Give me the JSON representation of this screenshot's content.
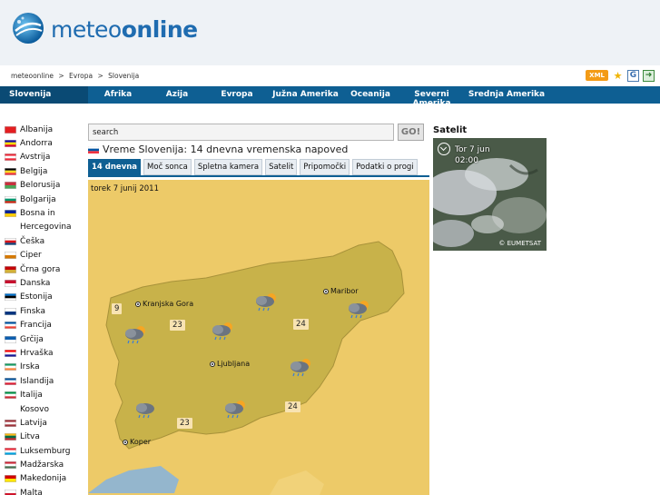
{
  "header": {
    "logo_light": "meteo",
    "logo_bold": "online"
  },
  "breadcrumb": [
    "meteoonline",
    ">",
    "Evropa",
    ">",
    "Slovenija"
  ],
  "header_icons": {
    "xml_label": "XML"
  },
  "nav": {
    "current": "Slovenija",
    "items": [
      "Afrika",
      "Azija",
      "Evropa",
      "Južna Amerika",
      "Oceanija",
      "Severni Amerika",
      "Srednja Amerika"
    ]
  },
  "sidebar": {
    "countries": [
      {
        "name": "Albanija",
        "flag": [
          "#e41e20",
          "#e41e20"
        ]
      },
      {
        "name": "Andorra",
        "flag": [
          "#10069f",
          "#fedd00",
          "#d50032"
        ]
      },
      {
        "name": "Avstrija",
        "flag": [
          "#ed2939",
          "#ffffff",
          "#ed2939"
        ]
      },
      {
        "name": "Belgija",
        "flag": [
          "#000000",
          "#fdda24",
          "#ef3340"
        ]
      },
      {
        "name": "Belorusija",
        "flag": [
          "#c8313e",
          "#4aa657"
        ]
      },
      {
        "name": "Bolgarija",
        "flag": [
          "#ffffff",
          "#00966e",
          "#d62612"
        ]
      },
      {
        "name": "Bosna in",
        "flag": [
          "#002395",
          "#fecb00"
        ]
      },
      {
        "name": "Hercegovina",
        "flag": null
      },
      {
        "name": "Češka",
        "flag": [
          "#ffffff",
          "#d7141a",
          "#11457e"
        ]
      },
      {
        "name": "Ciper",
        "flag": [
          "#ffffff",
          "#d57800"
        ]
      },
      {
        "name": "Črna gora",
        "flag": [
          "#c40308",
          "#d4af37"
        ]
      },
      {
        "name": "Danska",
        "flag": [
          "#c8102e",
          "#ffffff"
        ]
      },
      {
        "name": "Estonija",
        "flag": [
          "#0072ce",
          "#000000",
          "#ffffff"
        ]
      },
      {
        "name": "Finska",
        "flag": [
          "#ffffff",
          "#003580"
        ]
      },
      {
        "name": "Francija",
        "flag": [
          "#0055a4",
          "#ffffff",
          "#ef4135"
        ]
      },
      {
        "name": "Grčija",
        "flag": [
          "#0d5eaf",
          "#ffffff"
        ]
      },
      {
        "name": "Hrvaška",
        "flag": [
          "#ff0000",
          "#ffffff",
          "#171796"
        ]
      },
      {
        "name": "Irska",
        "flag": [
          "#169b62",
          "#ffffff",
          "#ff883e"
        ]
      },
      {
        "name": "Islandija",
        "flag": [
          "#02529c",
          "#ffffff",
          "#dc1e35"
        ]
      },
      {
        "name": "Italija",
        "flag": [
          "#009246",
          "#ffffff",
          "#ce2b37"
        ]
      },
      {
        "name": "Kosovo",
        "flag": null
      },
      {
        "name": "Latvija",
        "flag": [
          "#9e3039",
          "#ffffff",
          "#9e3039"
        ]
      },
      {
        "name": "Litva",
        "flag": [
          "#fdb913",
          "#006a44",
          "#c1272d"
        ]
      },
      {
        "name": "Luksemburg",
        "flag": [
          "#ed2939",
          "#ffffff",
          "#00a1de"
        ]
      },
      {
        "name": "Madžarska",
        "flag": [
          "#ce2939",
          "#ffffff",
          "#477050"
        ]
      },
      {
        "name": "Makedonija",
        "flag": [
          "#d20000",
          "#ffe600"
        ]
      },
      {
        "name": "Malta",
        "flag": [
          "#ffffff",
          "#cf142b"
        ]
      }
    ]
  },
  "search": {
    "value": "search",
    "go_label": "GO!"
  },
  "page_title": "Vreme Slovenija: 14 dnevna vremenska napoved",
  "tabs": [
    "14 dnevna",
    "Moč sonca",
    "Spletna kamera",
    "Satelit",
    "Pripomočki",
    "Podatki o progi"
  ],
  "map": {
    "date": "torek  7 junij 2011",
    "cities": [
      "Kranjska Gora",
      "Maribor",
      "Ljubljana",
      "Koper"
    ],
    "temps": [
      "9",
      "23",
      "24",
      "24",
      "23"
    ],
    "weather_icon": "cloud-sun-rain-icon"
  },
  "satellite": {
    "title": "Satelit",
    "day": "Tor  7 jun",
    "time": "02:00",
    "credit": "© EUMETSAT"
  },
  "colors": {
    "nav_bg": "#0e5f93",
    "nav_current_bg": "#0a4a74",
    "map_bg": "#edca68",
    "country_fill": "#c8b24a",
    "accent": "#1f6cb0"
  }
}
